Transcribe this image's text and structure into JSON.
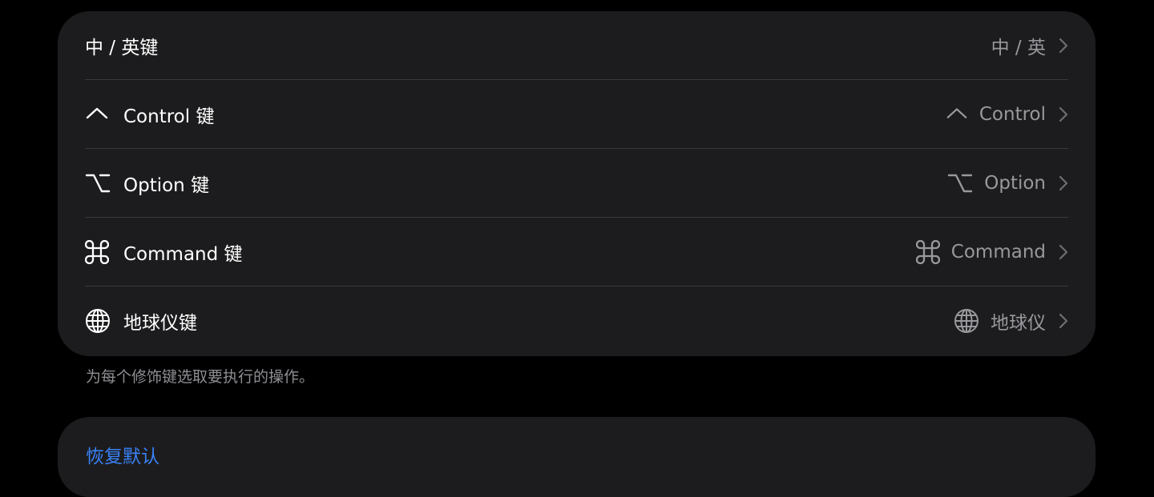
{
  "keys": [
    {
      "title": "中 / 英键",
      "value": "中 / 英",
      "icon": "none"
    },
    {
      "title": "Control 键",
      "value": "Control",
      "icon": "control-caret-icon"
    },
    {
      "title": "Option 键",
      "value": "Option",
      "icon": "option-key-icon"
    },
    {
      "title": "Command 键",
      "value": "Command",
      "icon": "command-key-icon"
    },
    {
      "title": "地球仪键",
      "value": "地球仪",
      "icon": "globe-icon"
    }
  ],
  "footnote": "为每个修饰键选取要执行的操作。",
  "reset_label": "恢复默认",
  "colors": {
    "background": "#000000",
    "group": "#1c1c1e",
    "separator": "#3a3a3c",
    "secondary": "#98989d",
    "accent": "#3a82f7"
  }
}
